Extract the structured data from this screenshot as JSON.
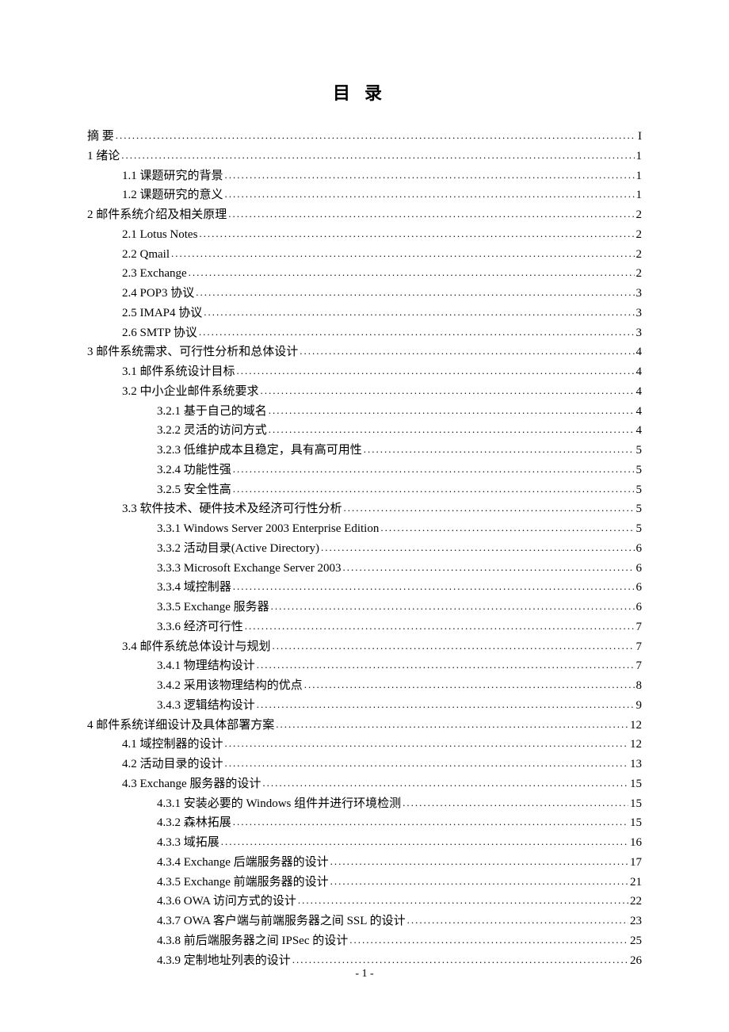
{
  "title": "目录",
  "footer": "- 1 -",
  "entries": [
    {
      "level": 0,
      "label": "摘   要",
      "page": "I",
      "spaced": false
    },
    {
      "level": 0,
      "label": "1  绪论",
      "page": "1"
    },
    {
      "level": 1,
      "label": "1.1  课题研究的背景",
      "page": "1"
    },
    {
      "level": 1,
      "label": "1.2  课题研究的意义",
      "page": "1"
    },
    {
      "level": 0,
      "label": "2  邮件系统介绍及相关原理",
      "page": "2"
    },
    {
      "level": 1,
      "label": "2.1 Lotus Notes",
      "page": "2"
    },
    {
      "level": 1,
      "label": "2.2 Qmail",
      "page": "2"
    },
    {
      "level": 1,
      "label": "2.3 Exchange",
      "page": "2"
    },
    {
      "level": 1,
      "label": "2.4 POP3 协议",
      "page": "3"
    },
    {
      "level": 1,
      "label": "2.5 IMAP4 协议",
      "page": "3"
    },
    {
      "level": 1,
      "label": "2.6 SMTP 协议",
      "page": "3"
    },
    {
      "level": 0,
      "label": "3  邮件系统需求、可行性分析和总体设计",
      "page": "4"
    },
    {
      "level": 1,
      "label": "3.1  邮件系统设计目标",
      "page": "4"
    },
    {
      "level": 1,
      "label": "3.2  中小企业邮件系统要求",
      "page": "4"
    },
    {
      "level": 2,
      "label": "3.2.1  基于自己的域名",
      "page": "4"
    },
    {
      "level": 2,
      "label": "3.2.2  灵活的访问方式",
      "page": "4"
    },
    {
      "level": 2,
      "label": "3.2.3  低维护成本且稳定，具有高可用性",
      "page": "5"
    },
    {
      "level": 2,
      "label": "3.2.4  功能性强",
      "page": "5"
    },
    {
      "level": 2,
      "label": "3.2.5  安全性高",
      "page": "5"
    },
    {
      "level": 1,
      "label": "3.3  软件技术、硬件技术及经济可行性分析",
      "page": "5"
    },
    {
      "level": 2,
      "label": "3.3.1 Windows Server 2003 Enterprise Edition",
      "page": "5"
    },
    {
      "level": 2,
      "label": "3.3.2  活动目录(Active Directory)",
      "page": "6"
    },
    {
      "level": 2,
      "label": "3.3.3 Microsoft Exchange Server 2003",
      "page": "6"
    },
    {
      "level": 2,
      "label": "3.3.4  域控制器",
      "page": "6"
    },
    {
      "level": 2,
      "label": "3.3.5 Exchange 服务器",
      "page": "6"
    },
    {
      "level": 2,
      "label": "3.3.6  经济可行性",
      "page": "7"
    },
    {
      "level": 1,
      "label": "3.4  邮件系统总体设计与规划",
      "page": "7"
    },
    {
      "level": 2,
      "label": "3.4.1  物理结构设计",
      "page": "7"
    },
    {
      "level": 2,
      "label": "3.4.2  采用该物理结构的优点",
      "page": "8"
    },
    {
      "level": 2,
      "label": "3.4.3  逻辑结构设计",
      "page": "9"
    },
    {
      "level": 0,
      "label": "4  邮件系统详细设计及具体部署方案",
      "page": "12"
    },
    {
      "level": 1,
      "label": "4.1  域控制器的设计",
      "page": "12"
    },
    {
      "level": 1,
      "label": "4.2  活动目录的设计",
      "page": "13"
    },
    {
      "level": 1,
      "label": "4.3 Exchange 服务器的设计",
      "page": "15"
    },
    {
      "level": 2,
      "label": "4.3.1  安装必要的 Windows 组件并进行环境检测",
      "page": "15"
    },
    {
      "level": 2,
      "label": "4.3.2  森林拓展",
      "page": "15"
    },
    {
      "level": 2,
      "label": "4.3.3  域拓展",
      "page": "16"
    },
    {
      "level": 2,
      "label": "4.3.4 Exchange 后端服务器的设计",
      "page": "17"
    },
    {
      "level": 2,
      "label": "4.3.5 Exchange 前端服务器的设计",
      "page": "21"
    },
    {
      "level": 2,
      "label": "4.3.6 OWA 访问方式的设计",
      "page": "22"
    },
    {
      "level": 2,
      "label": "4.3.7 OWA 客户端与前端服务器之间 SSL 的设计",
      "page": "23"
    },
    {
      "level": 2,
      "label": "4.3.8  前后端服务器之间 IPSec 的设计",
      "page": "25"
    },
    {
      "level": 2,
      "label": "4.3.9  定制地址列表的设计",
      "page": "26"
    }
  ]
}
